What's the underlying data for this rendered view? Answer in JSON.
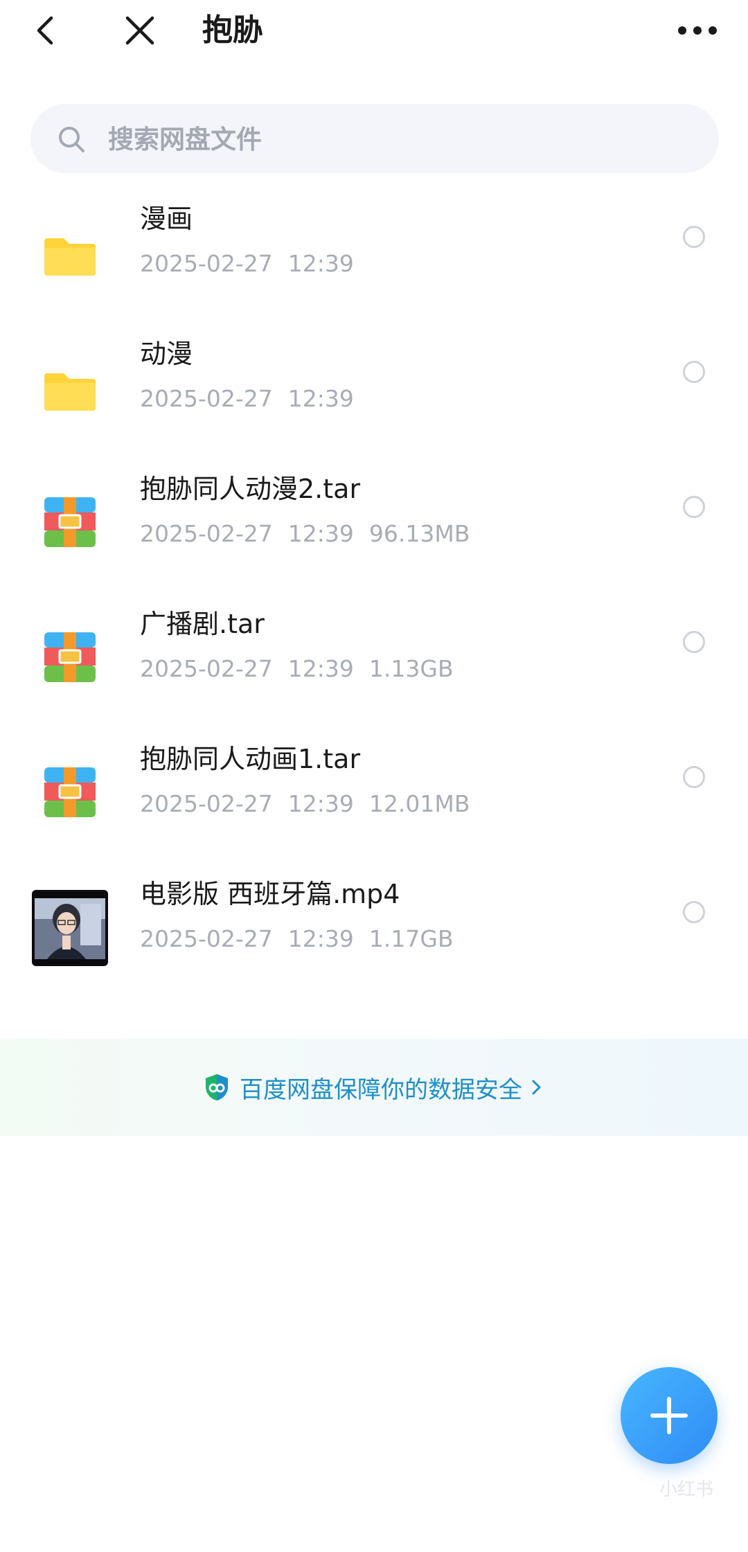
{
  "header": {
    "title": "抱胁",
    "back_icon": "chevron-left-icon",
    "close_icon": "close-icon",
    "more_icon": "more-horizontal-icon"
  },
  "search": {
    "placeholder": "搜索网盘文件",
    "icon": "search-icon"
  },
  "files": [
    {
      "name": "漫画",
      "date": "2025-02-27",
      "time": "12:39",
      "size": "",
      "type": "folder"
    },
    {
      "name": "动漫",
      "date": "2025-02-27",
      "time": "12:39",
      "size": "",
      "type": "folder"
    },
    {
      "name": "抱胁同人动漫2.tar",
      "date": "2025-02-27",
      "time": "12:39",
      "size": "96.13MB",
      "type": "archive"
    },
    {
      "name": "广播剧.tar",
      "date": "2025-02-27",
      "time": "12:39",
      "size": "1.13GB",
      "type": "archive"
    },
    {
      "name": "抱胁同人动画1.tar",
      "date": "2025-02-27",
      "time": "12:39",
      "size": "12.01MB",
      "type": "archive"
    },
    {
      "name": "电影版 西班牙篇.mp4",
      "date": "2025-02-27",
      "time": "12:39",
      "size": "1.17GB",
      "type": "video"
    }
  ],
  "banner": {
    "text": "百度网盘保障你的数据安全",
    "icon": "shield-icon"
  },
  "fab": {
    "icon": "plus-icon"
  },
  "watermark": "小红书",
  "colors": {
    "accent": "#2f8cf5",
    "banner_text": "#1e8fc8",
    "folder": "#ffd43b",
    "meta_text": "#a8acb4"
  }
}
